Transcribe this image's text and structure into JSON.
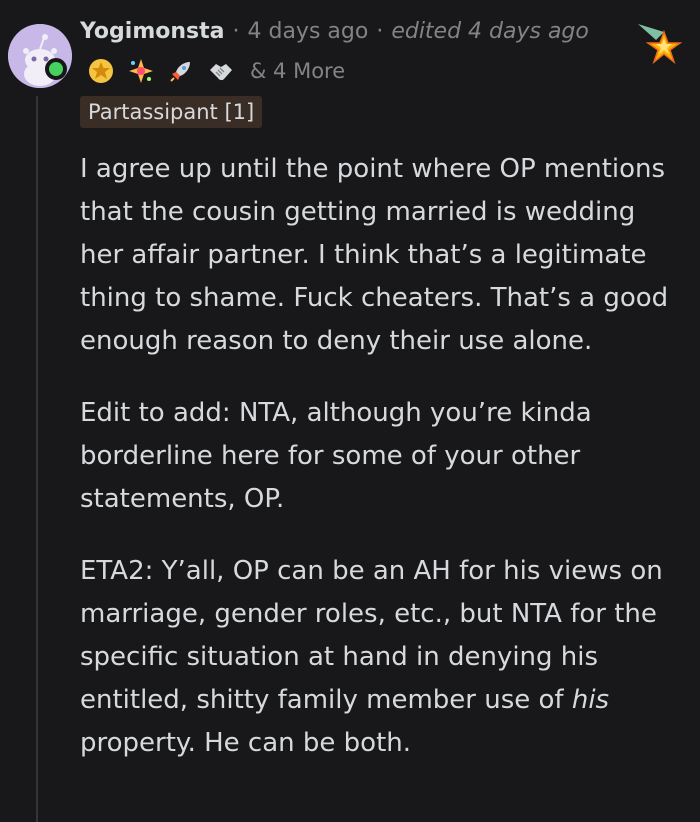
{
  "comment": {
    "username": "Yogimonsta",
    "time": "4 days ago",
    "edited": "edited 4 days ago",
    "more_awards": "& 4 More",
    "awards": [
      "gold-star-award-icon",
      "sparkle-award-icon",
      "rocket-award-icon",
      "handshake-award-icon"
    ],
    "flair": "Partassipant [1]",
    "paragraphs": [
      "I agree up until the point where OP mentions that the cousin getting married is wedding her affair partner. I think that’s a legitimate thing to shame. Fuck cheaters. That’s a good enough reason to deny their use alone.",
      "Edit to add: NTA, although you’re kinda borderline here for some of your other statements, OP."
    ],
    "p3": {
      "before": "ETA2: Y’all, OP can be an AH for his views on marriage, gender roles, etc., but NTA for the specific situation at hand in denying his entitled, shitty family member use of ",
      "em": "his",
      "after": " property. He can be both."
    }
  },
  "colors": {
    "background": "#18181a",
    "text": "#d7dadc",
    "meta": "#818384",
    "flair_bg": "#3a2d26",
    "online": "#46d160",
    "avatar_bg": "#c7b8e8"
  }
}
